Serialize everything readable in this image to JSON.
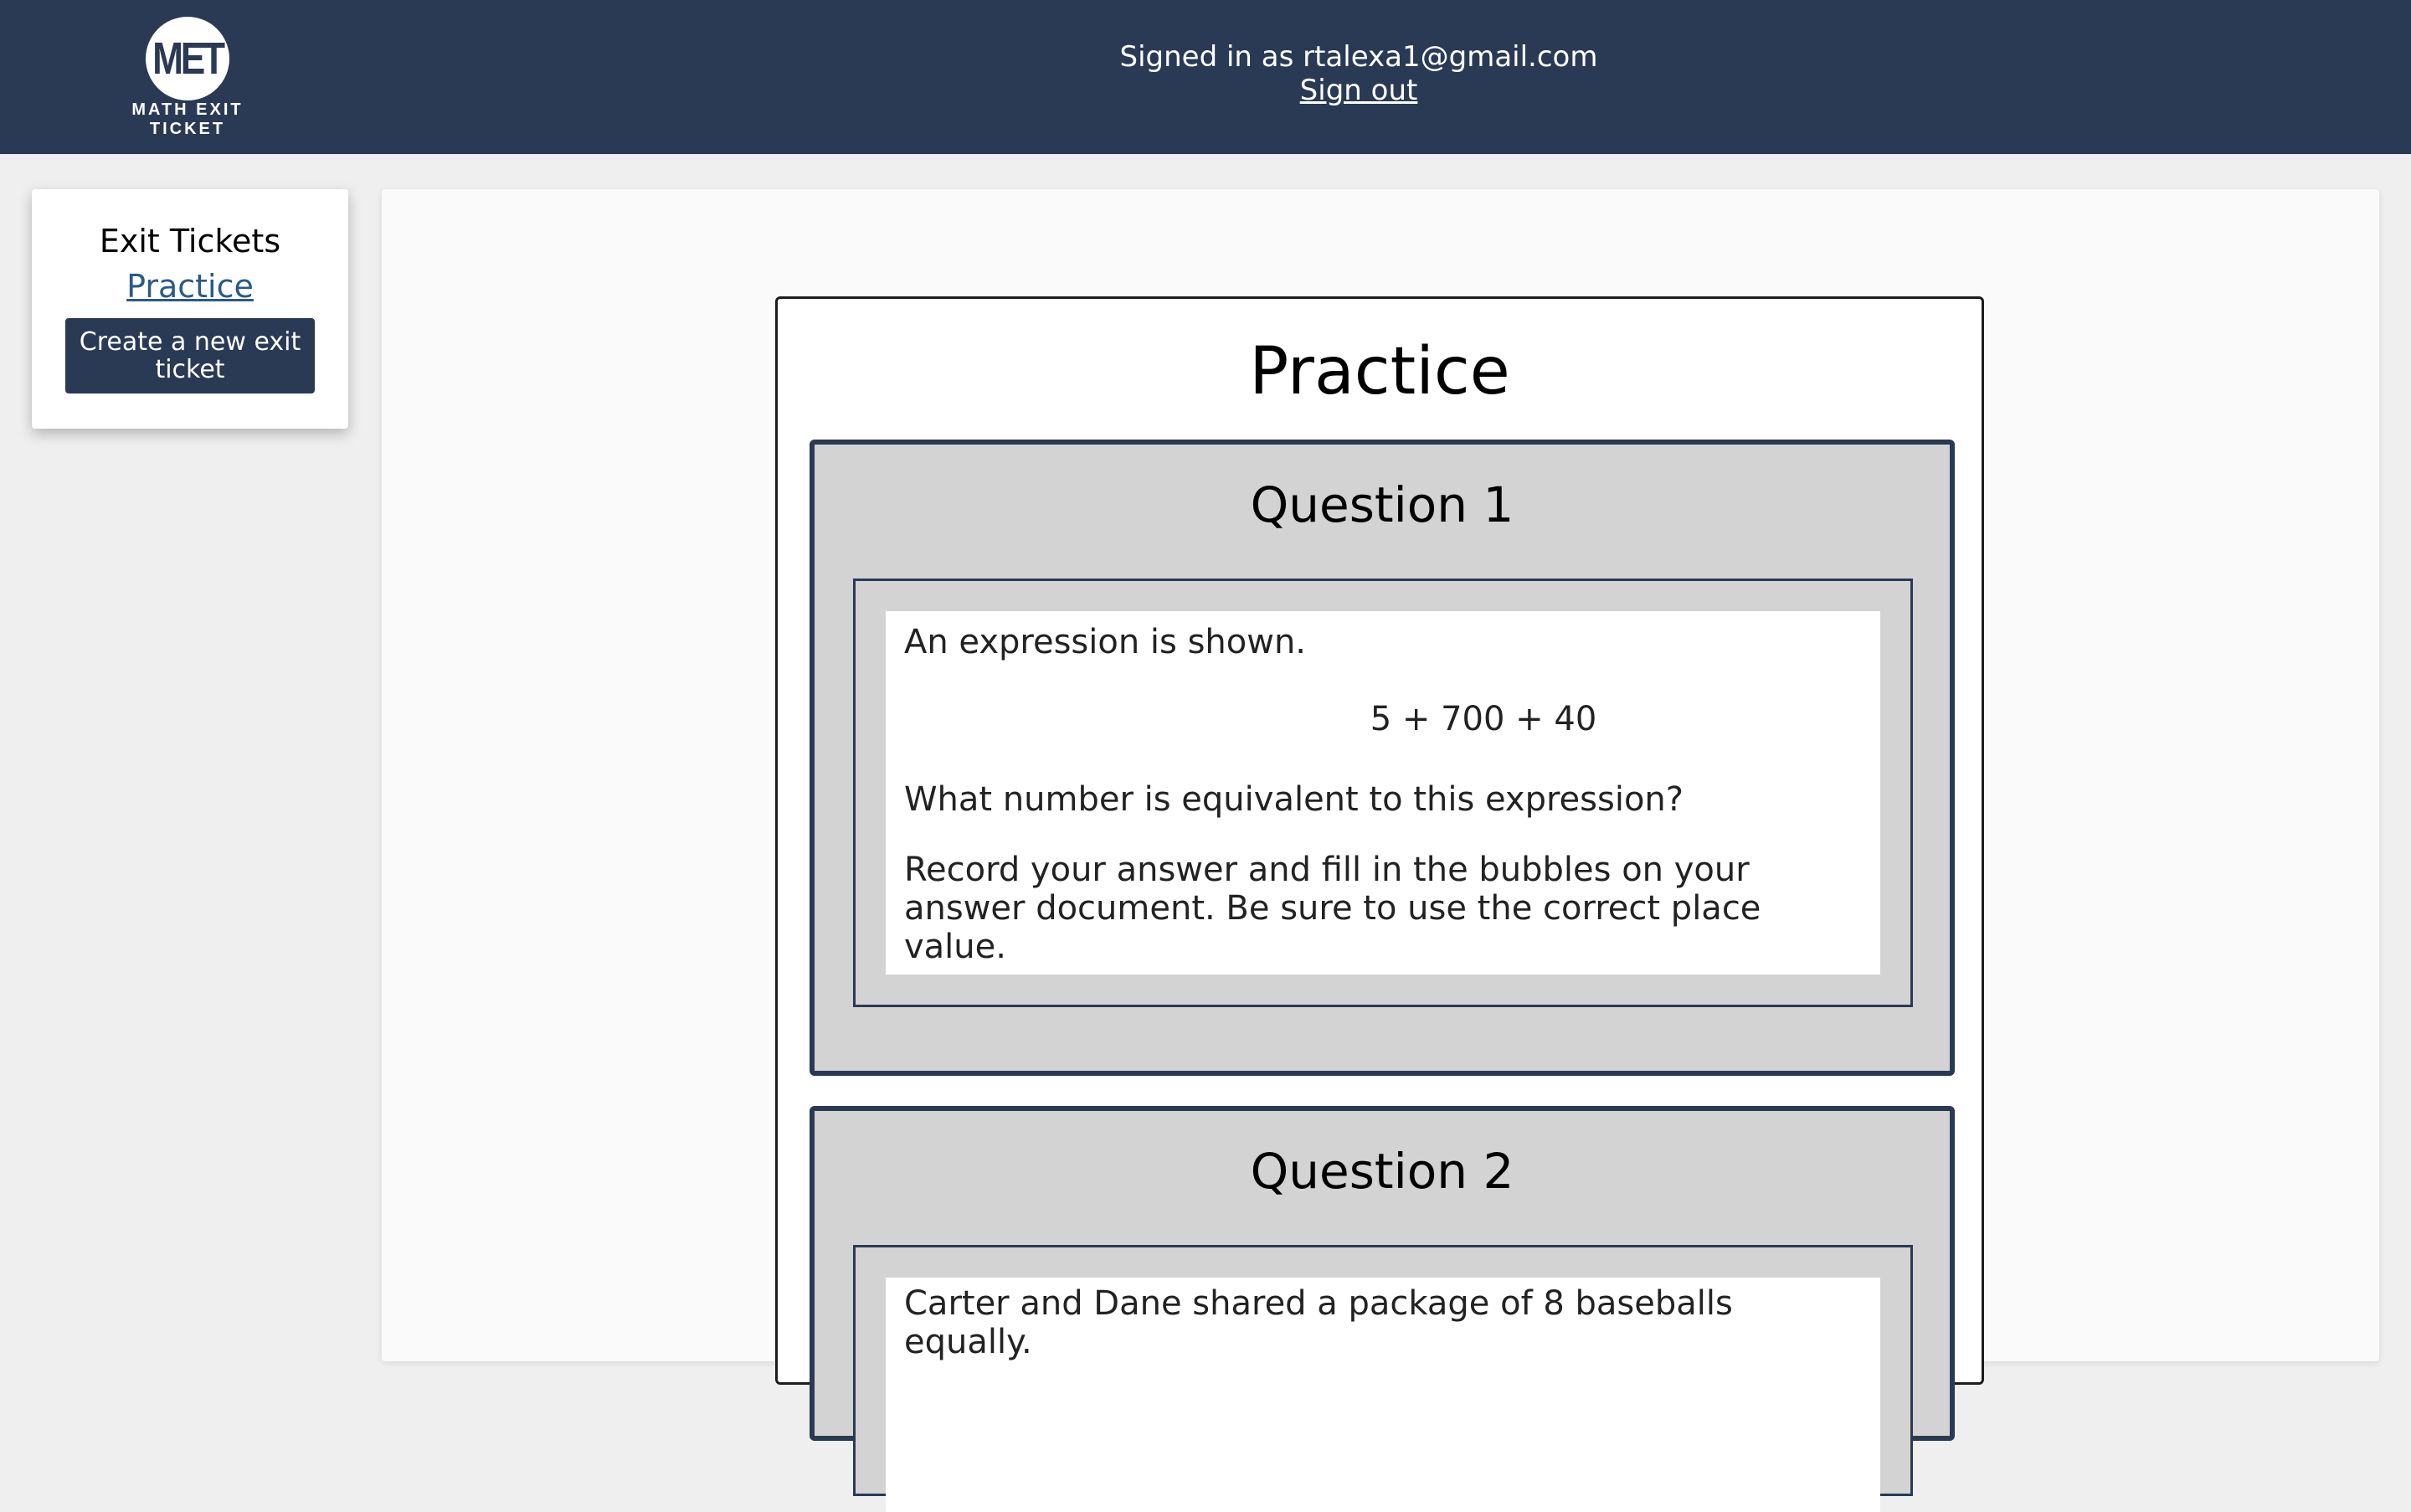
{
  "header": {
    "logo_text": "MET",
    "logo_subtitle": "MATH EXIT TICKET",
    "signed_in_text": "Signed in as rtalexa1@gmail.com",
    "sign_out_label": "Sign out"
  },
  "sidebar": {
    "title": "Exit Tickets",
    "items": [
      {
        "label": "Practice"
      }
    ],
    "create_button_label": "Create a new exit ticket"
  },
  "ticket": {
    "title": "Practice",
    "questions": [
      {
        "title": "Question 1",
        "line1": "An expression is shown.",
        "expression": "5 + 700 + 40",
        "line2": "What number is equivalent to this expression?",
        "line3": "Record your answer and fill in the bubbles on your answer document. Be sure to use the correct place value."
      },
      {
        "title": "Question 2",
        "line1": "Carter and Dane shared a package of 8 baseballs equally."
      }
    ]
  },
  "colors": {
    "header_bg": "#2a3a55",
    "question_border": "#2a3a55",
    "link": "#2a5a8a"
  }
}
